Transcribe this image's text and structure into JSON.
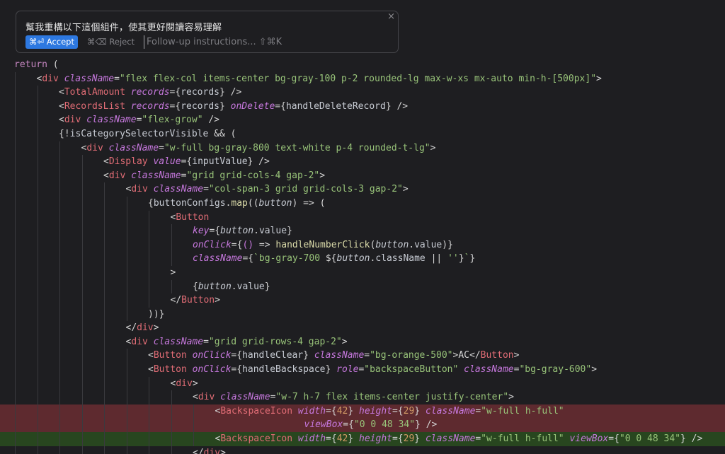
{
  "prompt": {
    "text": "幫我重構以下這個組件，使其更好閱讀容易理解",
    "accept_label": "⌘⏎ Accept",
    "reject_label": "⌘⌫ Reject",
    "followup_placeholder": "Follow-up instructions... ⇧⌘K",
    "close_glyph": "×"
  },
  "colors": {
    "background": "#1e1e21",
    "accept_button": "#2d78e0",
    "deleted_line": "#5e2a2f",
    "added_line": "#28461f",
    "tag": "#e06c75",
    "attribute": "#c678dd",
    "string": "#98c379",
    "number": "#d19a66"
  },
  "code": {
    "lines": [
      {
        "indent": 0,
        "state": "normal",
        "tokens": [
          [
            "kw",
            "return"
          ],
          [
            "punc",
            " ("
          ]
        ]
      },
      {
        "indent": 1,
        "state": "normal",
        "tokens": [
          [
            "punc",
            "<"
          ],
          [
            "tag",
            "div"
          ],
          [
            "punc",
            " "
          ],
          [
            "attr",
            "className"
          ],
          [
            "punc",
            "="
          ],
          [
            "str",
            "\"flex flex-col items-center bg-gray-100 p-2 rounded-lg max-w-xs mx-auto min-h-[500px]\""
          ],
          [
            "punc",
            ">"
          ]
        ]
      },
      {
        "indent": 2,
        "state": "normal",
        "tokens": [
          [
            "punc",
            "<"
          ],
          [
            "tag",
            "TotalAmount"
          ],
          [
            "punc",
            " "
          ],
          [
            "attr",
            "records"
          ],
          [
            "punc",
            "={"
          ],
          [
            "var",
            "records"
          ],
          [
            "punc",
            "} />"
          ]
        ]
      },
      {
        "indent": 2,
        "state": "normal",
        "tokens": [
          [
            "punc",
            "<"
          ],
          [
            "tag",
            "RecordsList"
          ],
          [
            "punc",
            " "
          ],
          [
            "attr",
            "records"
          ],
          [
            "punc",
            "={"
          ],
          [
            "var",
            "records"
          ],
          [
            "punc",
            "} "
          ],
          [
            "attr",
            "onDelete"
          ],
          [
            "punc",
            "={"
          ],
          [
            "var",
            "handleDeleteRecord"
          ],
          [
            "punc",
            "} />"
          ]
        ]
      },
      {
        "indent": 2,
        "state": "normal",
        "tokens": [
          [
            "punc",
            "<"
          ],
          [
            "tag",
            "div"
          ],
          [
            "punc",
            " "
          ],
          [
            "attr",
            "className"
          ],
          [
            "punc",
            "="
          ],
          [
            "str",
            "\"flex-grow\""
          ],
          [
            "punc",
            " />"
          ]
        ]
      },
      {
        "indent": 2,
        "state": "normal",
        "tokens": [
          [
            "punc",
            "{!"
          ],
          [
            "var",
            "isCategorySelectorVisible"
          ],
          [
            "punc",
            " && ("
          ]
        ]
      },
      {
        "indent": 3,
        "state": "normal",
        "tokens": [
          [
            "punc",
            "<"
          ],
          [
            "tag",
            "div"
          ],
          [
            "punc",
            " "
          ],
          [
            "attr",
            "className"
          ],
          [
            "punc",
            "="
          ],
          [
            "str",
            "\"w-full bg-gray-800 text-white p-4 rounded-t-lg\""
          ],
          [
            "punc",
            ">"
          ]
        ]
      },
      {
        "indent": 4,
        "state": "normal",
        "tokens": [
          [
            "punc",
            "<"
          ],
          [
            "tag",
            "Display"
          ],
          [
            "punc",
            " "
          ],
          [
            "attr",
            "value"
          ],
          [
            "punc",
            "={"
          ],
          [
            "var",
            "inputValue"
          ],
          [
            "punc",
            "} />"
          ]
        ]
      },
      {
        "indent": 4,
        "state": "normal",
        "tokens": [
          [
            "punc",
            "<"
          ],
          [
            "tag",
            "div"
          ],
          [
            "punc",
            " "
          ],
          [
            "attr",
            "className"
          ],
          [
            "punc",
            "="
          ],
          [
            "str",
            "\"grid grid-cols-4 gap-2\""
          ],
          [
            "punc",
            ">"
          ]
        ]
      },
      {
        "indent": 5,
        "state": "normal",
        "tokens": [
          [
            "punc",
            "<"
          ],
          [
            "tag",
            "div"
          ],
          [
            "punc",
            " "
          ],
          [
            "attr",
            "className"
          ],
          [
            "punc",
            "="
          ],
          [
            "str",
            "\"col-span-3 grid grid-cols-3 gap-2\""
          ],
          [
            "punc",
            ">"
          ]
        ]
      },
      {
        "indent": 6,
        "state": "normal",
        "tokens": [
          [
            "punc",
            "{"
          ],
          [
            "var",
            "buttonConfigs"
          ],
          [
            "punc",
            "."
          ],
          [
            "fn",
            "map"
          ],
          [
            "punc",
            "(("
          ],
          [
            "varit",
            "button"
          ],
          [
            "punc",
            ") => ("
          ]
        ]
      },
      {
        "indent": 7,
        "state": "normal",
        "tokens": [
          [
            "punc",
            "<"
          ],
          [
            "tag",
            "Button"
          ]
        ]
      },
      {
        "indent": 8,
        "state": "normal",
        "tokens": [
          [
            "attr",
            "key"
          ],
          [
            "punc",
            "={"
          ],
          [
            "varit",
            "button"
          ],
          [
            "punc",
            "."
          ],
          [
            "var",
            "value"
          ],
          [
            "punc",
            "}"
          ]
        ]
      },
      {
        "indent": 8,
        "state": "normal",
        "tokens": [
          [
            "attr",
            "onClick"
          ],
          [
            "punc",
            "={"
          ],
          [
            "bl",
            "()"
          ],
          [
            "punc",
            " => "
          ],
          [
            "fn",
            "handleNumberClick"
          ],
          [
            "punc",
            "("
          ],
          [
            "varit",
            "button"
          ],
          [
            "punc",
            "."
          ],
          [
            "var",
            "value"
          ],
          [
            "punc",
            ")}"
          ]
        ]
      },
      {
        "indent": 8,
        "state": "normal",
        "tokens": [
          [
            "attr",
            "className"
          ],
          [
            "punc",
            "={"
          ],
          [
            "str",
            "`bg-gray-700 "
          ],
          [
            "punc",
            "${"
          ],
          [
            "varit",
            "button"
          ],
          [
            "punc",
            "."
          ],
          [
            "var",
            "className"
          ],
          [
            "punc",
            " || "
          ],
          [
            "str",
            "''"
          ],
          [
            "punc",
            "}"
          ],
          [
            "str",
            "`"
          ],
          [
            "punc",
            "}"
          ]
        ]
      },
      {
        "indent": 7,
        "state": "normal",
        "tokens": [
          [
            "punc",
            ">"
          ]
        ]
      },
      {
        "indent": 8,
        "state": "normal",
        "tokens": [
          [
            "punc",
            "{"
          ],
          [
            "varit",
            "button"
          ],
          [
            "punc",
            "."
          ],
          [
            "var",
            "value"
          ],
          [
            "punc",
            "}"
          ]
        ]
      },
      {
        "indent": 7,
        "state": "normal",
        "tokens": [
          [
            "punc",
            "</"
          ],
          [
            "tag",
            "Button"
          ],
          [
            "punc",
            ">"
          ]
        ]
      },
      {
        "indent": 6,
        "state": "normal",
        "tokens": [
          [
            "punc",
            "))}"
          ]
        ]
      },
      {
        "indent": 5,
        "state": "normal",
        "tokens": [
          [
            "punc",
            "</"
          ],
          [
            "tag",
            "div"
          ],
          [
            "punc",
            ">"
          ]
        ]
      },
      {
        "indent": 5,
        "state": "normal",
        "tokens": [
          [
            "punc",
            "<"
          ],
          [
            "tag",
            "div"
          ],
          [
            "punc",
            " "
          ],
          [
            "attr",
            "className"
          ],
          [
            "punc",
            "="
          ],
          [
            "str",
            "\"grid grid-rows-4 gap-2\""
          ],
          [
            "punc",
            ">"
          ]
        ]
      },
      {
        "indent": 6,
        "state": "normal",
        "tokens": [
          [
            "punc",
            "<"
          ],
          [
            "tag",
            "Button"
          ],
          [
            "punc",
            " "
          ],
          [
            "attr",
            "onClick"
          ],
          [
            "punc",
            "={"
          ],
          [
            "var",
            "handleClear"
          ],
          [
            "punc",
            "} "
          ],
          [
            "attr",
            "className"
          ],
          [
            "punc",
            "="
          ],
          [
            "str",
            "\"bg-orange-500\""
          ],
          [
            "punc",
            ">AC</"
          ],
          [
            "tag",
            "Button"
          ],
          [
            "punc",
            ">"
          ]
        ]
      },
      {
        "indent": 6,
        "state": "normal",
        "tokens": [
          [
            "punc",
            "<"
          ],
          [
            "tag",
            "Button"
          ],
          [
            "punc",
            " "
          ],
          [
            "attr",
            "onClick"
          ],
          [
            "punc",
            "={"
          ],
          [
            "var",
            "handleBackspace"
          ],
          [
            "punc",
            "} "
          ],
          [
            "attr",
            "role"
          ],
          [
            "punc",
            "="
          ],
          [
            "str",
            "\"backspaceButton\""
          ],
          [
            "punc",
            " "
          ],
          [
            "attr",
            "className"
          ],
          [
            "punc",
            "="
          ],
          [
            "str",
            "\"bg-gray-600\""
          ],
          [
            "punc",
            ">"
          ]
        ]
      },
      {
        "indent": 7,
        "state": "normal",
        "tokens": [
          [
            "punc",
            "<"
          ],
          [
            "tag",
            "div"
          ],
          [
            "punc",
            ">"
          ]
        ]
      },
      {
        "indent": 8,
        "state": "normal",
        "tokens": [
          [
            "punc",
            "<"
          ],
          [
            "tag",
            "div"
          ],
          [
            "punc",
            " "
          ],
          [
            "attr",
            "className"
          ],
          [
            "punc",
            "="
          ],
          [
            "str",
            "\"w-7 h-7 flex items-center justify-center\""
          ],
          [
            "punc",
            ">"
          ]
        ]
      },
      {
        "indent": 9,
        "state": "del",
        "tokens": [
          [
            "punc",
            "<"
          ],
          [
            "tag",
            "BackspaceIcon"
          ],
          [
            "punc",
            " "
          ],
          [
            "attr",
            "width"
          ],
          [
            "punc",
            "={"
          ],
          [
            "num",
            "42"
          ],
          [
            "punc",
            "} "
          ],
          [
            "attr",
            "height"
          ],
          [
            "punc",
            "={"
          ],
          [
            "num",
            "29"
          ],
          [
            "punc",
            "} "
          ],
          [
            "attr",
            "className"
          ],
          [
            "punc",
            "="
          ],
          [
            "str",
            "\"w-full h-full\""
          ]
        ]
      },
      {
        "indent": 13,
        "state": "del",
        "tokens": [
          [
            "attr",
            "viewBox"
          ],
          [
            "punc",
            "={"
          ],
          [
            "str",
            "\"0 0 48 34\""
          ],
          [
            "punc",
            "} />"
          ]
        ]
      },
      {
        "indent": 9,
        "state": "add",
        "tokens": [
          [
            "punc",
            "<"
          ],
          [
            "tag",
            "BackspaceIcon"
          ],
          [
            "punc",
            " "
          ],
          [
            "attr",
            "width"
          ],
          [
            "punc",
            "={"
          ],
          [
            "num",
            "42"
          ],
          [
            "punc",
            "} "
          ],
          [
            "attr",
            "height"
          ],
          [
            "punc",
            "={"
          ],
          [
            "num",
            "29"
          ],
          [
            "punc",
            "} "
          ],
          [
            "attr",
            "className"
          ],
          [
            "punc",
            "="
          ],
          [
            "str",
            "\"w-full h-full\""
          ],
          [
            "punc",
            " "
          ],
          [
            "attr",
            "viewBox"
          ],
          [
            "punc",
            "={"
          ],
          [
            "str",
            "\"0 0 48 34\""
          ],
          [
            "punc",
            "} />"
          ]
        ]
      },
      {
        "indent": 8,
        "state": "normal",
        "tokens": [
          [
            "punc",
            "</"
          ],
          [
            "tag",
            "div"
          ],
          [
            "punc",
            ">"
          ]
        ]
      }
    ]
  }
}
